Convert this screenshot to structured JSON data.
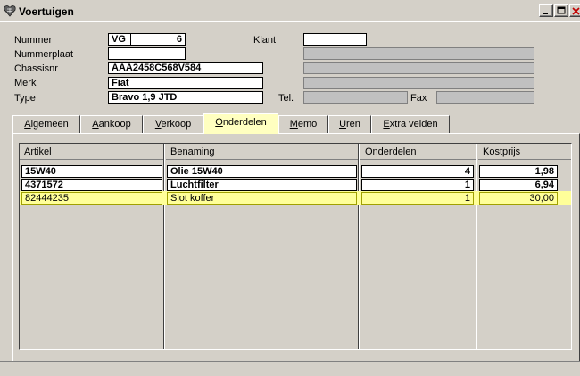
{
  "window": {
    "title": "Voertuigen",
    "title_icon": "heart-shield-icon"
  },
  "form": {
    "nummer_label": "Nummer",
    "nummer_prefix": "VG",
    "nummer_value": "6",
    "klant_label": "Klant",
    "klant_value": "",
    "nummerplaat_label": "Nummerplaat",
    "nummerplaat_value": "",
    "chassisnr_label": "Chassisnr",
    "chassisnr_value": "AAA2458C568V584",
    "merk_label": "Merk",
    "merk_value": "Fiat",
    "type_label": "Type",
    "type_value": "Bravo 1,9 JTD",
    "tel_label": "Tel.",
    "tel_value": "",
    "fax_label": "Fax",
    "fax_value": ""
  },
  "tabs": [
    {
      "label": "Algemeen"
    },
    {
      "label": "Aankoop"
    },
    {
      "label": "Verkoop"
    },
    {
      "label": "Onderdelen",
      "active": true
    },
    {
      "label": "Memo"
    },
    {
      "label": "Uren"
    },
    {
      "label": "Extra velden"
    }
  ],
  "grid": {
    "columns": [
      "Artikel",
      "Benaming",
      "Onderdelen",
      "Kostprijs"
    ],
    "rows": [
      {
        "artikel": "15W40",
        "benaming": "Olie 15W40",
        "onderdelen": "4",
        "kostprijs": "1,98"
      },
      {
        "artikel": "4371572",
        "benaming": "Luchtfilter",
        "onderdelen": "1",
        "kostprijs": "6,94"
      },
      {
        "artikel": "82444235",
        "benaming": "Slot koffer",
        "onderdelen": "1",
        "kostprijs": "30,00"
      }
    ]
  },
  "colors": {
    "active_tab": "#ffffc0",
    "highlight_row": "#ffff99",
    "window_bg": "#d4d0c8"
  }
}
